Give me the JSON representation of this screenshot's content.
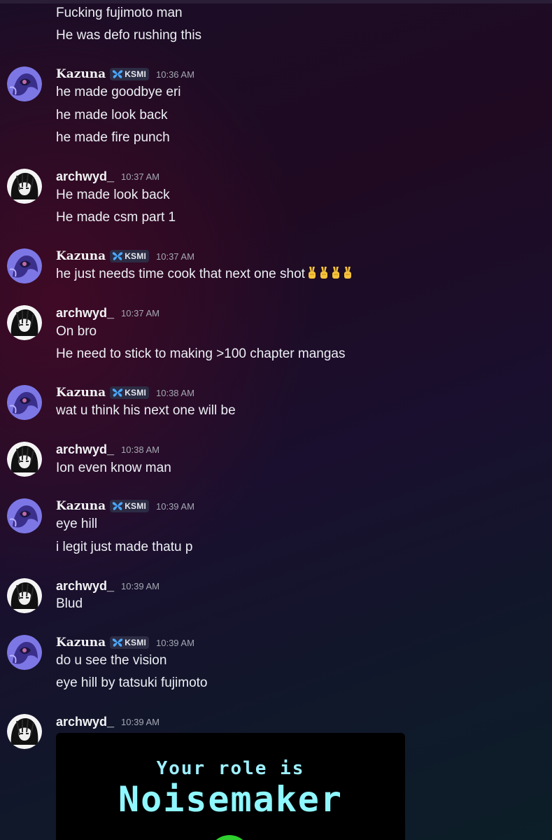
{
  "colors": {
    "background_start": "#1b0d26",
    "background_end": "#0c1e28",
    "kazuna_avatar": "#7d77e6",
    "archwyd_avatar": "#111111",
    "tag_bg": "#2c2c44",
    "tag_icon": "#4aa8ff",
    "timestamp": "#a4a8b3",
    "embed_text": "#8ff7ff",
    "embed_dot": "#2ecf2e"
  },
  "icons": {
    "tag": "butterfly-icon",
    "emoji": "victory-hand-emoji"
  },
  "top": {
    "lines": [
      "Fucking fujimoto man",
      "He was defo rushing this"
    ]
  },
  "messages": [
    {
      "author": "Kazuna",
      "tag": "KSMI",
      "time": "10:36 AM",
      "lines": [
        "he made goodbye eri",
        "he made look back",
        "he made fire punch"
      ]
    },
    {
      "author": "archwyd_",
      "time": "10:37 AM",
      "lines": [
        "He made look back",
        "He made csm part 1"
      ]
    },
    {
      "author": "Kazuna",
      "tag": "KSMI",
      "time": "10:37 AM",
      "lines": [
        "he just needs time cook that next one shot"
      ]
    },
    {
      "author": "archwyd_",
      "time": "10:37 AM",
      "lines": [
        "On bro",
        "He need to stick to making >100 chapter mangas"
      ]
    },
    {
      "author": "Kazuna",
      "tag": "KSMI",
      "time": "10:38 AM",
      "lines": [
        "wat u think his next one will be"
      ]
    },
    {
      "author": "archwyd_",
      "time": "10:38 AM",
      "lines": [
        "Ion even know man"
      ]
    },
    {
      "author": "Kazuna",
      "tag": "KSMI",
      "time": "10:39 AM",
      "lines": [
        "eye hill",
        "i legit just made thatu p"
      ]
    },
    {
      "author": "archwyd_",
      "time": "10:39 AM",
      "lines": [
        "Blud"
      ]
    },
    {
      "author": "Kazuna",
      "tag": "KSMI",
      "time": "10:39 AM",
      "lines": [
        "do u see the vision",
        "eye hill by tatsuki fujimoto"
      ]
    },
    {
      "author": "archwyd_",
      "time": "10:39 AM",
      "lines": []
    }
  ],
  "embed": {
    "subtitle": "Your role is",
    "title": "Noisemaker"
  }
}
